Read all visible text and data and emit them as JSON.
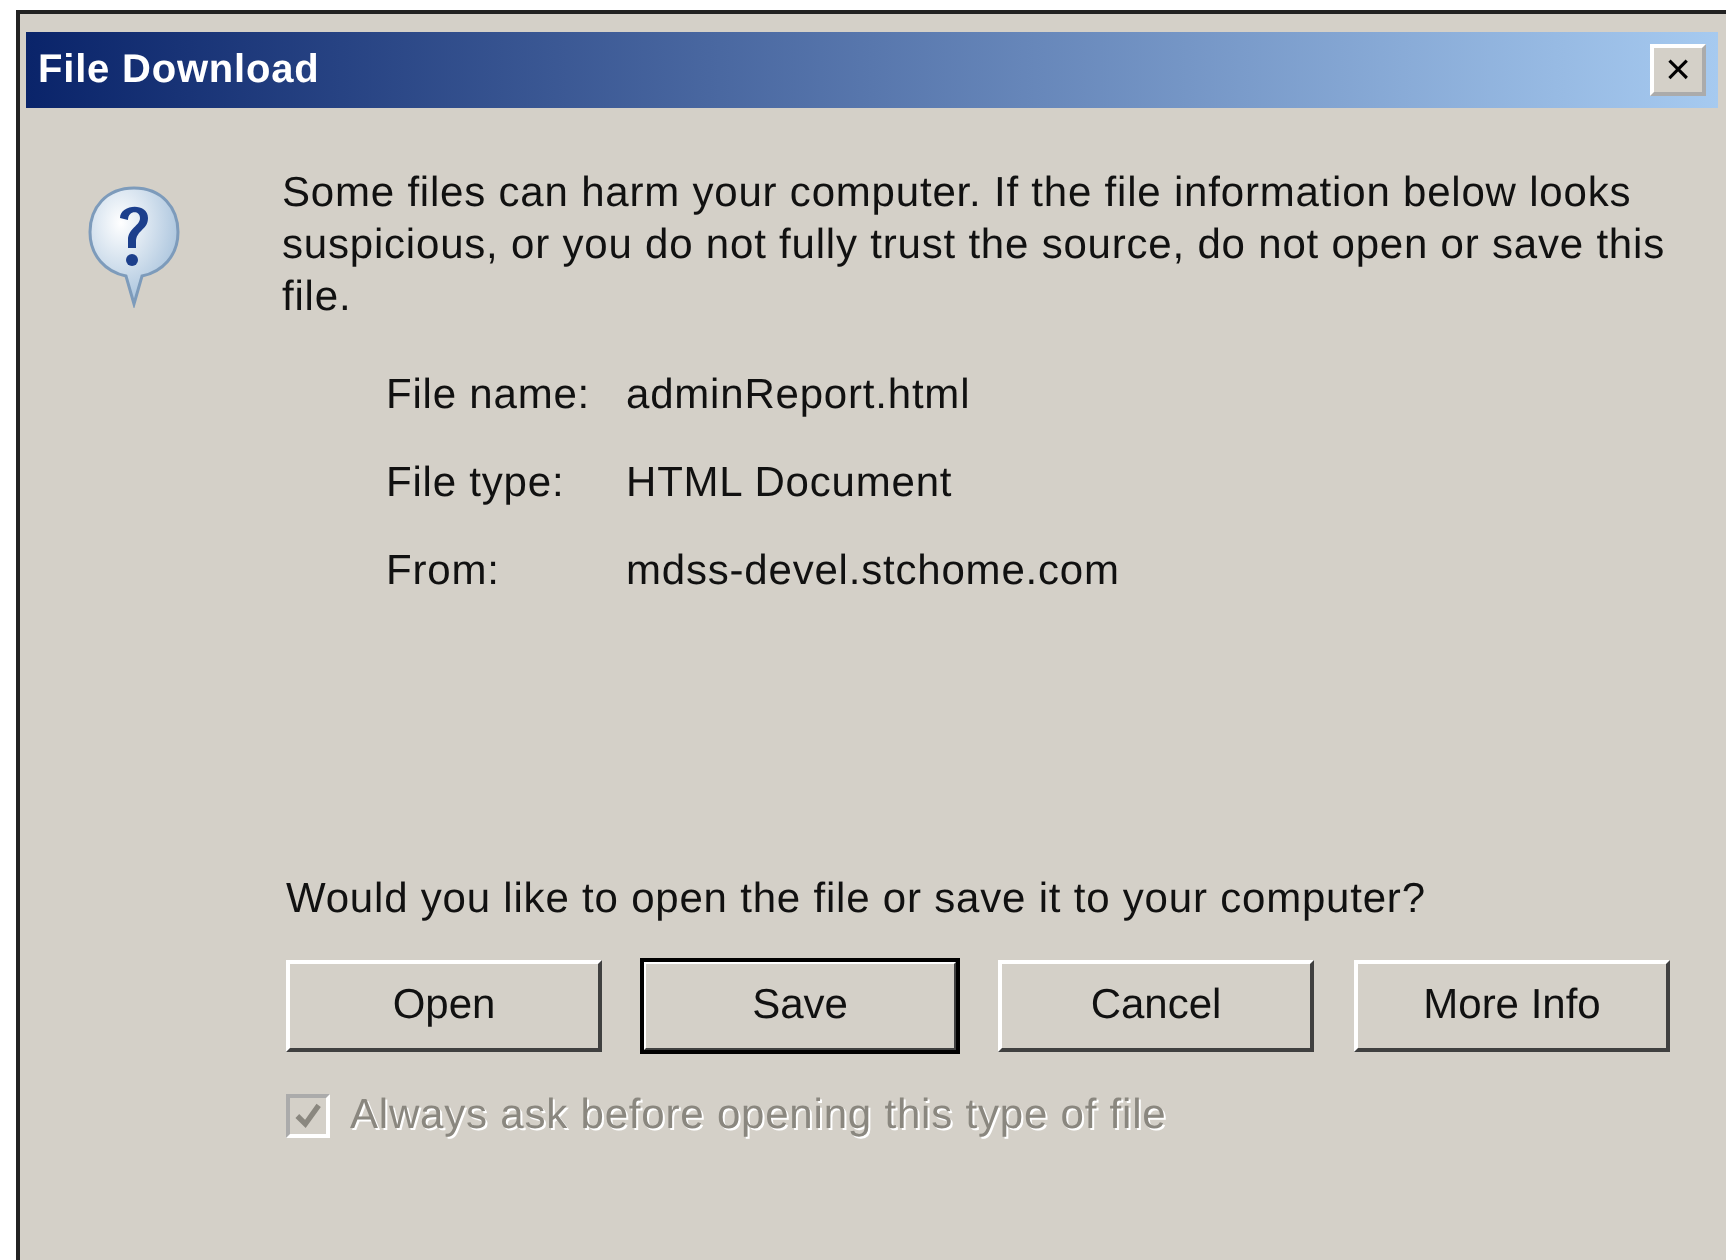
{
  "window": {
    "title": "File Download",
    "close": "×"
  },
  "message": "Some files can harm your computer. If the file information below looks suspicious, or you do not fully trust the source, do not open or save this file.",
  "info": [
    {
      "label": "File name:",
      "value": "adminReport.html"
    },
    {
      "label": "File type:",
      "value": "HTML Document"
    },
    {
      "label": "From:",
      "value": "mdss-devel.stchome.com"
    }
  ],
  "question": "Would you like to open the file or save it to your computer?",
  "buttons": [
    {
      "label": "Open",
      "default": false
    },
    {
      "label": "Save",
      "default": true
    },
    {
      "label": "Cancel",
      "default": false
    },
    {
      "label": "More Info",
      "default": false
    }
  ],
  "checkbox": {
    "label": "Always ask before opening this type of file",
    "checked": true,
    "disabled": true
  }
}
